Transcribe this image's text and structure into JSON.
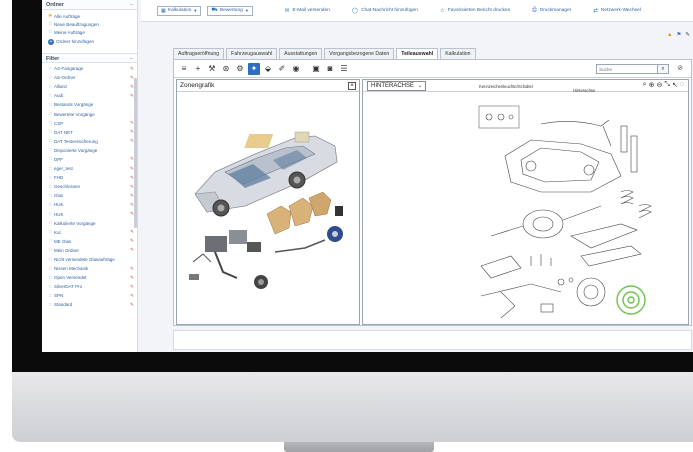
{
  "sidebar": {
    "ordner_title": "Ordner",
    "ordner_items": [
      {
        "label": "Alle Aufträge",
        "starred": true
      },
      {
        "label": "Neue Beauftragungen",
        "starred": false
      },
      {
        "label": "Meine Aufträge",
        "starred": false
      }
    ],
    "add_folder_label": "Ordner hinzufügen",
    "filter_title": "Filter",
    "filters": [
      {
        "label": "AS-Fairgarage",
        "edit": true
      },
      {
        "label": "AS-Ordner",
        "edit": true
      },
      {
        "label": "Allianz",
        "edit": true
      },
      {
        "label": "Audi",
        "edit": true
      },
      {
        "label": "Bestands Vorgänge",
        "edit": false
      },
      {
        "label": "Bewertete Vorgänge",
        "edit": false
      },
      {
        "label": "CSP",
        "edit": true
      },
      {
        "label": "DAT NET",
        "edit": true
      },
      {
        "label": "DAT Testversicherung",
        "edit": true
      },
      {
        "label": "Disponierte Vorgänge",
        "edit": false
      },
      {
        "label": "DPF",
        "edit": true
      },
      {
        "label": "eger_test",
        "edit": true
      },
      {
        "label": "FHD",
        "edit": true
      },
      {
        "label": "Geschlossen",
        "edit": true
      },
      {
        "label": "Glas",
        "edit": true
      },
      {
        "label": "HUK",
        "edit": true
      },
      {
        "label": "HUK",
        "edit": true
      },
      {
        "label": "Kalkulierte Vorgänge",
        "edit": false
      },
      {
        "label": "Kul.",
        "edit": true
      },
      {
        "label": "ME Glas",
        "edit": true
      },
      {
        "label": "Mein Ordner",
        "edit": true
      },
      {
        "label": "Nicht versendete Glasaufträge",
        "edit": false
      },
      {
        "label": "Nissen Mechanik",
        "edit": true
      },
      {
        "label": "Open Versendet",
        "edit": true
      },
      {
        "label": "SilverDAT Pro",
        "edit": true
      },
      {
        "label": "SPN",
        "edit": true
      },
      {
        "label": "Standard",
        "edit": true
      }
    ]
  },
  "toolbar": {
    "kalkulation": "Kalkulation",
    "bewertung": "Bewertung",
    "email": "E-Mail versenden",
    "chat": "Chat-Nachricht hinzufügen",
    "print_fav": "Favorisierten Bericht drucken",
    "druckmanager": "Druckmanager",
    "netzwerk": "Netzwerk-Wechsel"
  },
  "tabs": [
    "Auftragseröffnung",
    "Fahrzeugauswahl",
    "Ausstattungen",
    "Vorgangsbezogene Daten",
    "Teileauswahl",
    "Kalkulation"
  ],
  "active_tab": "Teileauswahl",
  "search": {
    "placeholder": "Suche"
  },
  "left_pane": {
    "title": "Zonengrafik",
    "close": "×"
  },
  "right_pane": {
    "selected": "HINTERACHSE",
    "labels": {
      "kennzeichen": "Kennzeichenleuchte/Schalter",
      "hinterachse": "Hinterachse"
    }
  },
  "icons": {
    "accent": "#2f6fc0",
    "edit_color": "#d33a3a",
    "star_color": "#e0a700",
    "highlight": "#6cc24a"
  }
}
